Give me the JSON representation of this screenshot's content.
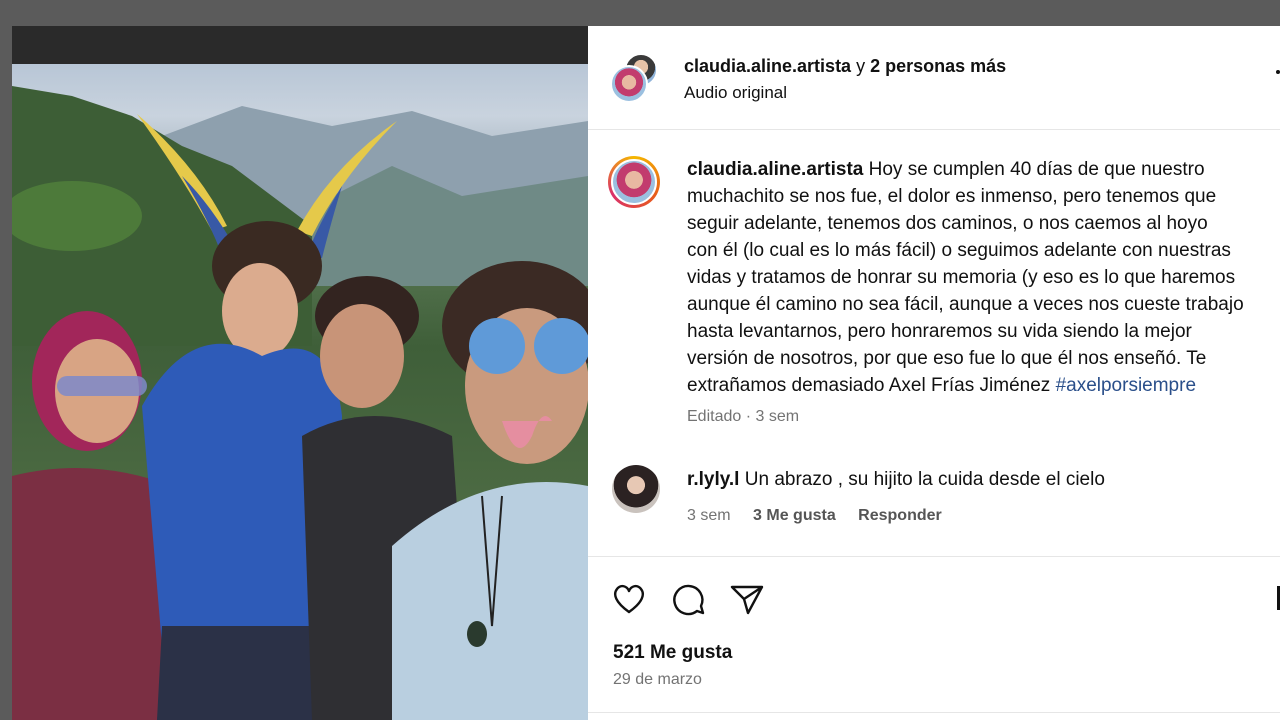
{
  "header": {
    "username": "claudia.aline.artista",
    "connector": "y",
    "others": "2 personas más",
    "audio": "Audio original"
  },
  "caption": {
    "username": "claudia.aline.artista",
    "lines": [
      "Hoy se cumplen 40 días de que nuestro",
      "muchachito se nos fue, el dolor es inmenso, pero tenemos que",
      "seguir adelante, tenemos dos caminos, o nos caemos al hoyo",
      "con él (lo cual es lo más fácil) o seguimos adelante con nuestras",
      "vidas y tratamos de honrar su memoria (y eso es lo que haremos",
      "aunque él camino no sea fácil, aunque a veces nos cueste trabajo",
      "hasta levantarnos, pero honraremos su vida siendo la mejor",
      "versión de nosotros, por que eso fue lo que él nos enseñó. Te",
      "extrañamos demasiado Axel Frías Jiménez"
    ],
    "hashtag": "#axelporsiempre",
    "edited": "Editado · 3 sem"
  },
  "comment": {
    "username": "r.lyly.l",
    "text": "Un abrazo , su hijito la cuida desde el cielo",
    "time": "3 sem",
    "likes": "3 Me gusta",
    "reply": "Responder"
  },
  "actions": {
    "like_icon": "heart-icon",
    "comment_icon": "comment-icon",
    "share_icon": "send-icon"
  },
  "post": {
    "likes": "521 Me gusta",
    "date": "29 de marzo"
  },
  "colors": {
    "hashtag": "#2a4f8a",
    "muted": "#737373",
    "backdrop": "#5b5b5b"
  }
}
